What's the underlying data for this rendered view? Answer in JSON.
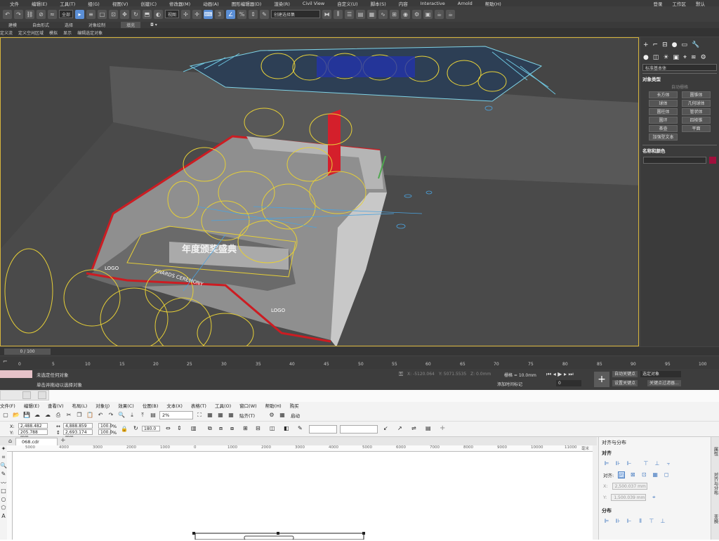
{
  "max": {
    "menu": [
      "文件",
      "编辑(E)",
      "工具(T)",
      "组(G)",
      "视图(V)",
      "创建(C)",
      "修改器(M)",
      "动画(A)",
      "图形编辑器(D)",
      "渲染(R)",
      "Civil View",
      "自定义(U)",
      "脚本(S)",
      "内容",
      "Interactive",
      "Arnold",
      "帮助(H)"
    ],
    "right": [
      "登录",
      "工作区",
      "默认"
    ],
    "toolbar": {
      "select_filter": "全部",
      "ref_coord": "视图",
      "named_sel": "创建选择集"
    },
    "ribbon": [
      "建模",
      "自由形式",
      "选择",
      "对象绘制",
      "填充"
    ],
    "subbar": [
      "定义流",
      "定义空闲区域",
      "模拟",
      "显示",
      "编辑选定对象"
    ],
    "command_panel": {
      "dropdown": "标准基本体",
      "section_object_type": "对象类型",
      "autogrid": "自动栅格",
      "buttons": [
        "长方体",
        "圆锥体",
        "球体",
        "几何球体",
        "圆柱体",
        "管状体",
        "圆环",
        "四棱锥",
        "茶壶",
        "平面",
        "加强型文本"
      ],
      "section_name_color": "名称和颜色",
      "swatch_color": "#a0103c"
    },
    "scene": {
      "stage_text": "AWARDS CEREMONY",
      "logo_text": "LOGO",
      "banner_text": "年度颁奖盛典"
    },
    "time_slider": "0 / 100",
    "track_ticks": [
      "0",
      "5",
      "10",
      "15",
      "20",
      "25",
      "30",
      "35",
      "40",
      "45",
      "50",
      "55",
      "60",
      "65",
      "70",
      "75",
      "80",
      "85",
      "90",
      "95",
      "100"
    ],
    "status": {
      "line1": "未选定任何对象",
      "line2": "单击并拖动以选择对象",
      "x": "X: -5120.064",
      "y": "Y: 5071.5535",
      "z": "Z: 0.0mm",
      "grid": "栅格 = 10.0mm",
      "add_time_tag": "添加时间标记",
      "frame": "0",
      "auto_key": "自动关键点",
      "set_key": "设置关键点",
      "selected": "选定对象",
      "key_filters": "关键点过滤器..."
    }
  },
  "cdr": {
    "menu": [
      "文件(F)",
      "编辑(E)",
      "查看(V)",
      "布局(L)",
      "对象(J)",
      "效果(C)",
      "位图(B)",
      "文本(X)",
      "表格(T)",
      "工具(O)",
      "窗口(W)",
      "帮助(H)",
      "购买"
    ],
    "zoom": "2%",
    "snap": "贴齐(T)",
    "launch": "启动",
    "x_label": "X:",
    "y_label": "Y:",
    "x": "2,488.482 mm",
    "y": "205.788 mm",
    "w": "4,888.859 mm",
    "h": "2,693.174 mm",
    "sx": "100.0",
    "sy": "100.0",
    "pct": "%",
    "angle": "180.0",
    "doc_tab": "068.cdr",
    "ruler": [
      "5000",
      "4000",
      "3000",
      "2000",
      "1000",
      "0",
      "1000",
      "2000",
      "3000",
      "4000",
      "5000",
      "6000",
      "7000",
      "8000",
      "9000",
      "10000",
      "11000"
    ],
    "ruler_unit": "毫米",
    "dock": {
      "title": "对齐与分布",
      "align": "对齐",
      "align_to": "对齐:",
      "x_val": "2,500.037 mm",
      "y_val": "1,500.039 mm",
      "distribute": "分布"
    },
    "dock_side": [
      "属性",
      "对齐与分布",
      "变换"
    ]
  }
}
